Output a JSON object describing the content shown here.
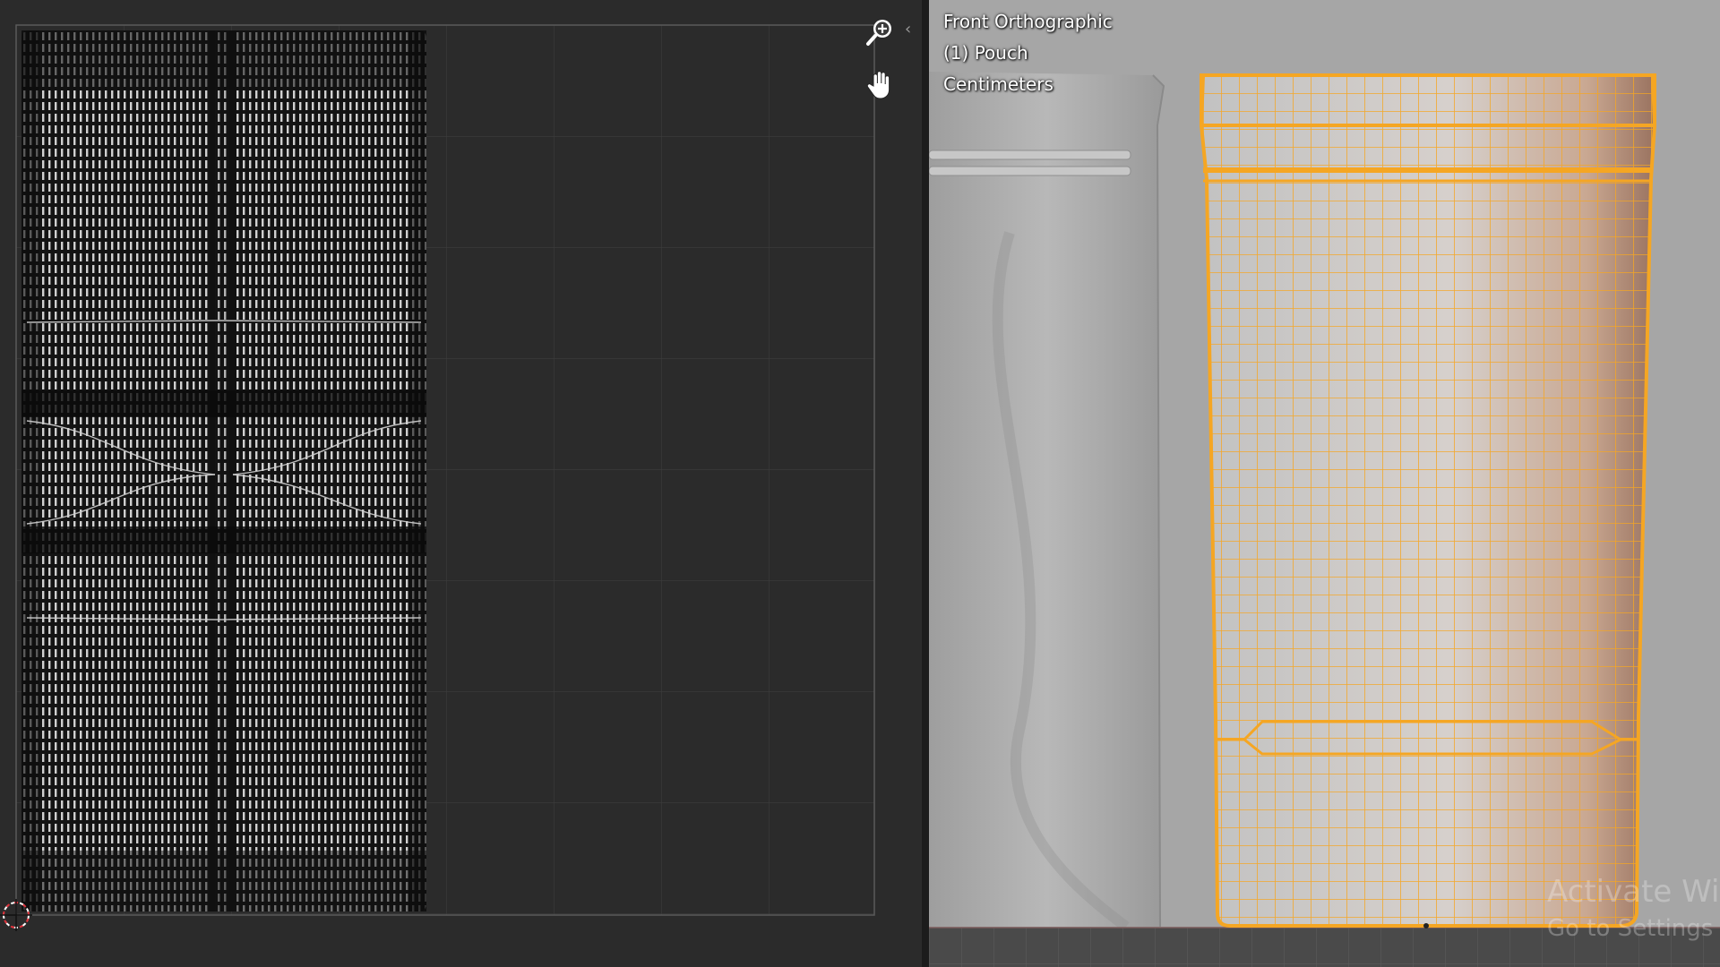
{
  "uv_editor": {
    "zoom_icon": "zoom-in-magnifier-icon",
    "pan_icon": "hand-pan-icon",
    "cursor_icon": "2d-cursor-icon",
    "collapse_icon": "chevron-left-icon",
    "collapse_glyph": "‹"
  },
  "viewport": {
    "view_name": "Front Orthographic",
    "object_label": "(1) Pouch",
    "units": "Centimeters",
    "wireframe_color": "#f5a623"
  },
  "watermark": {
    "line1": "Activate Windows",
    "line2": "Go to Settings to activate Windows."
  },
  "colors": {
    "uv_background": "#2b2b2b",
    "uv_grid": "#3c3c3c",
    "uv_mesh": "#d8d8d8",
    "viewport_background": "#a6a6a6",
    "selection": "#f5a623"
  }
}
